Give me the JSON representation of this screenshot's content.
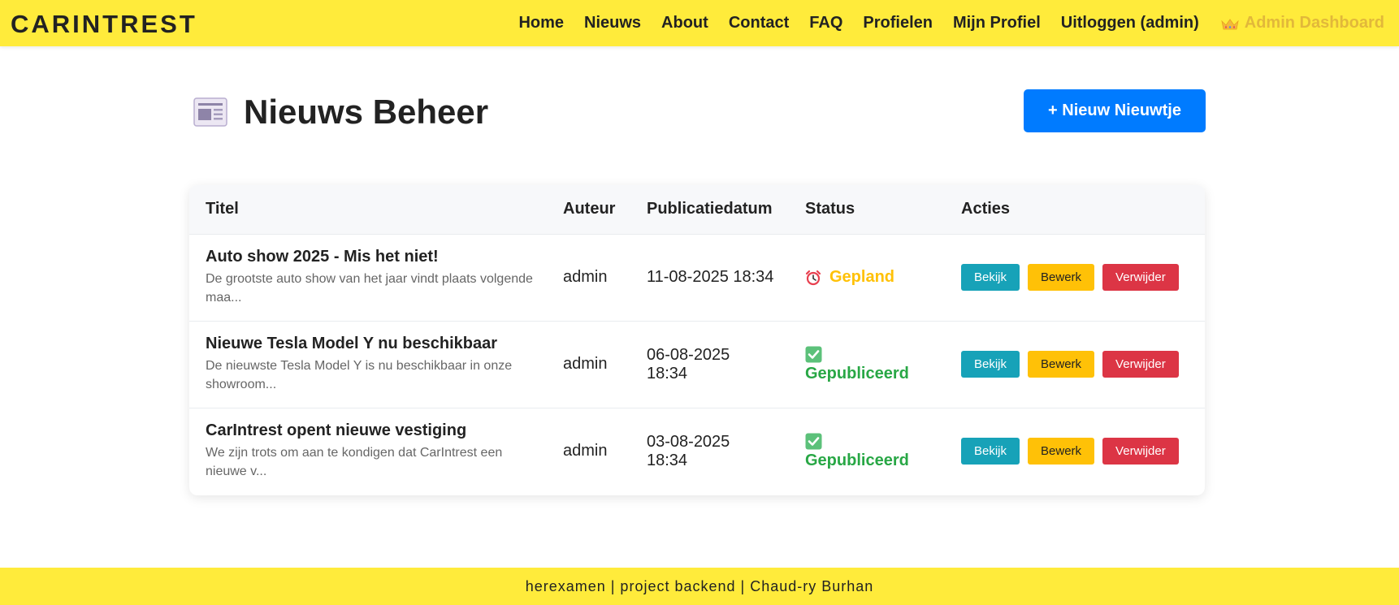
{
  "header": {
    "brand": "CARINTREST",
    "nav": [
      "Home",
      "Nieuws",
      "About",
      "Contact",
      "FAQ",
      "Profielen",
      "Mijn Profiel",
      "Uitloggen (admin)"
    ],
    "admin_link": "Admin Dashboard",
    "admin_icon": "crown-icon"
  },
  "page": {
    "icon": "newspaper-icon",
    "title": "Nieuws Beheer",
    "new_button": "+ Nieuw Nieuwtje"
  },
  "table": {
    "columns": [
      "Titel",
      "Auteur",
      "Publicatiedatum",
      "Status",
      "Acties"
    ],
    "rows": [
      {
        "title": "Auto show 2025 - Mis het niet!",
        "excerpt": "De grootste auto show van het jaar vindt plaats volgende maa...",
        "author": "admin",
        "date": "11-08-2025 18:34",
        "status": "Gepland",
        "status_icon": "alarm-clock-icon"
      },
      {
        "title": "Nieuwe Tesla Model Y nu beschikbaar",
        "excerpt": "De nieuwste Tesla Model Y is nu beschikbaar in onze showroom...",
        "author": "admin",
        "date": "06-08-2025 18:34",
        "status": "Gepubliceerd",
        "status_icon": "check-mark-icon"
      },
      {
        "title": "CarIntrest opent nieuwe vestiging",
        "excerpt": "We zijn trots om aan te kondigen dat CarIntrest een nieuwe v...",
        "author": "admin",
        "date": "03-08-2025 18:34",
        "status": "Gepubliceerd",
        "status_icon": "check-mark-icon"
      }
    ],
    "actions": {
      "view": "Bekijk",
      "edit": "Bewerk",
      "delete": "Verwijder"
    }
  },
  "footer": {
    "text": "herexamen | project backend | Chaud-ry Burhan"
  },
  "colors": {
    "header_bg": "#ffeb3b",
    "primary": "#007bff",
    "info": "#17a2b8",
    "warning": "#ffc107",
    "danger": "#dc3545",
    "success": "#28a745"
  }
}
